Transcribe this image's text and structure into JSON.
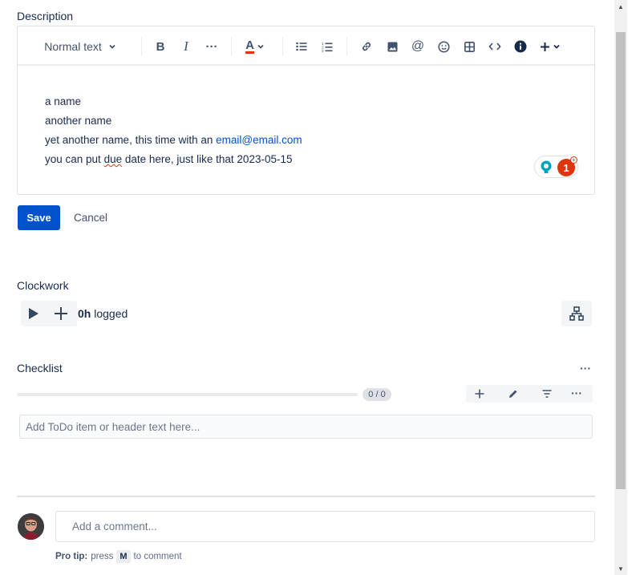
{
  "description": {
    "title": "Description",
    "toolbar": {
      "text_style": "Normal text",
      "bold": "B",
      "italic": "I",
      "more": "···",
      "text_color": "A"
    },
    "lines": [
      {
        "text": "a name"
      },
      {
        "text": "another name"
      },
      {
        "text": "yet another name, this time with an ",
        "link": "email@email.com"
      },
      {
        "pre": "you can put ",
        "misspelled": "due",
        "post": " date here, just like that 2023-05-15"
      }
    ],
    "badge_count": "1",
    "save_label": "Save",
    "cancel_label": "Cancel"
  },
  "clockwork": {
    "title": "Clockwork",
    "logged_value": "0h",
    "logged_label": "logged"
  },
  "checklist": {
    "title": "Checklist",
    "more": "···",
    "progress_fraction": 0,
    "counter": "0 / 0",
    "todo_placeholder": "Add ToDo item or header text here..."
  },
  "comment": {
    "placeholder": "Add a comment...",
    "protip_label": "Pro tip:",
    "protip_pre": "press",
    "protip_key": "M",
    "protip_post": "to comment"
  },
  "colors": {
    "primary": "#0052cc",
    "link": "#0052cc",
    "badge_red": "#de350b",
    "badge_teal": "#00a3bf"
  }
}
